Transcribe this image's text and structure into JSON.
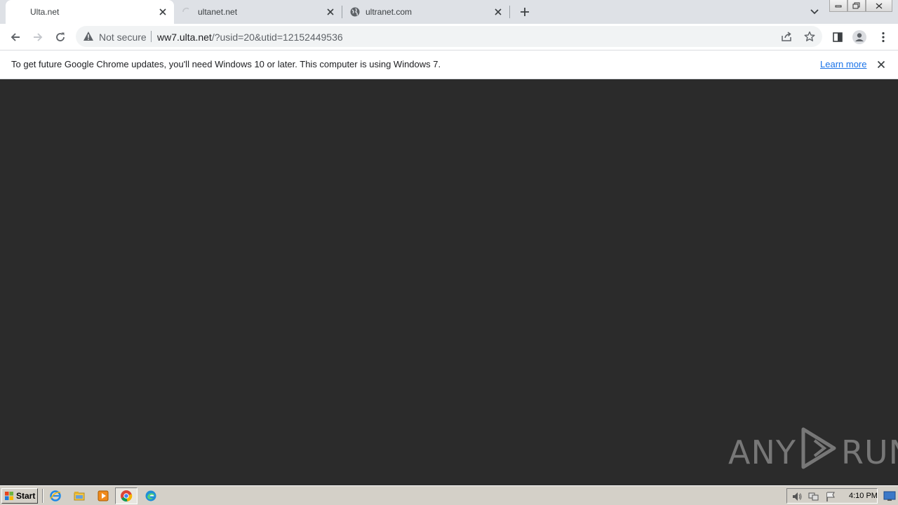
{
  "tabs": [
    {
      "title": "Ulta.net",
      "active": true
    },
    {
      "title": "ultanet.net",
      "active": false
    },
    {
      "title": "ultranet.com",
      "active": false
    }
  ],
  "toolbar": {
    "security_label": "Not secure",
    "url_host": "ww7.ulta.net",
    "url_path": "/?usid=20&utid=12152449536"
  },
  "infobar": {
    "message": "To get future Google Chrome updates, you'll need Windows 10 or later. This computer is using Windows 7.",
    "link": "Learn more"
  },
  "watermark": {
    "left": "ANY",
    "right": "RUN"
  },
  "taskbar": {
    "start_label": "Start",
    "clock": "4:10 PM"
  },
  "colors": {
    "tabstrip": "#dee1e6",
    "content_bg": "#2b2b2b",
    "link": "#1a73e8",
    "taskbar": "#d4d0c8"
  }
}
